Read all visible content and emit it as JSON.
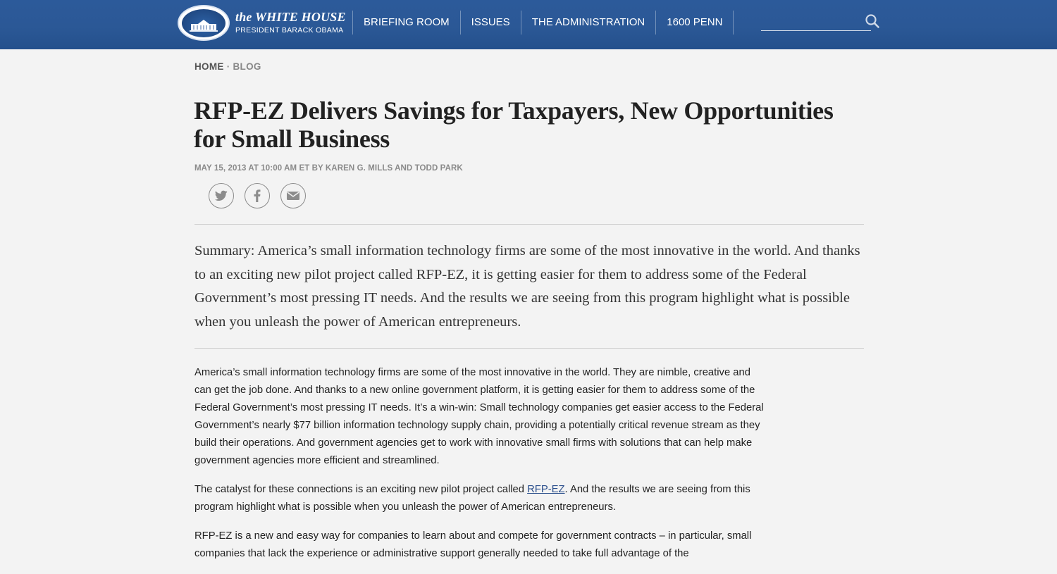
{
  "header": {
    "logo_title": "the WHITE HOUSE",
    "logo_subtitle": "PRESIDENT BARACK OBAMA",
    "nav": [
      "BRIEFING ROOM",
      "ISSUES",
      "THE ADMINISTRATION",
      "1600 PENN"
    ],
    "search_icon": "search-icon",
    "colors": {
      "bar": "#2b5896",
      "text": "#ffffff"
    }
  },
  "breadcrumb": {
    "home": "HOME",
    "separator": "·",
    "current": "BLOG"
  },
  "article": {
    "title": "RFP-EZ Delivers Savings for Taxpayers, New Opportunities for Small Business",
    "meta": "MAY 15, 2013 AT 10:00 AM ET BY KAREN G. MILLS AND TODD PARK",
    "share": [
      "twitter-icon",
      "facebook-icon",
      "email-icon"
    ],
    "summary": "Summary: America’s small information technology firms are some of the most innovative in the world. And thanks to an exciting new pilot project called RFP-EZ, it is getting easier for them to address some of the Federal Government’s most pressing IT needs. And the results we are seeing from this program highlight what is possible when you unleash the power of American entrepreneurs.",
    "paragraph1": "America’s small information technology firms are some of the most innovative in the world. They are nimble, creative and can get the job done. And thanks to a new online government platform, it is getting easier for them to address some of the Federal Government’s most pressing IT needs. It’s a win-win: Small technology companies get easier access to the Federal Government’s nearly $77 billion information technology supply chain, providing a potentially critical revenue stream as they build their operations. And government agencies get to work with innovative small firms with solutions that can help make government agencies more efficient and streamlined.",
    "paragraph2_before": "The catalyst for these connections is an exciting new pilot project called ",
    "paragraph2_link": "RFP-EZ",
    "paragraph2_after": ". And the results we are seeing from this program highlight what is possible when you unleash the power of American entrepreneurs.",
    "paragraph3": "RFP-EZ is a new and easy way for companies to learn about and compete for government contracts – in particular, small companies that lack the experience or administrative support generally needed to take full advantage of the"
  }
}
